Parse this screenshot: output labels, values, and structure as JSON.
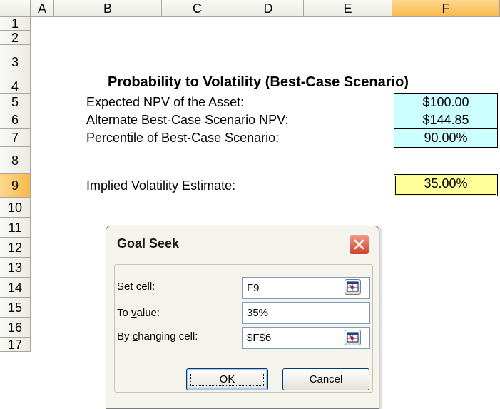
{
  "columns": [
    "A",
    "B",
    "C",
    "D",
    "E",
    "F"
  ],
  "rows": [
    "1",
    "2",
    "3",
    "4",
    "5",
    "6",
    "7",
    "8",
    "9",
    "10",
    "11",
    "12",
    "13",
    "14",
    "15",
    "16",
    "17"
  ],
  "sheet": {
    "title": "Probability to Volatility (Best-Case Scenario)",
    "expected_npv_label": "Expected NPV of the Asset:",
    "expected_npv_value": "$100.00",
    "alternate_npv_label": "Alternate Best-Case Scenario NPV:",
    "alternate_npv_value": "$144.85",
    "percentile_label": "Percentile of Best-Case Scenario:",
    "percentile_value": "90.00%",
    "implied_vol_label": "Implied Volatility Estimate:",
    "implied_vol_value": "35.00%"
  },
  "dialog": {
    "title": "Goal Seek",
    "set_cell_label_pre": "S",
    "set_cell_label_key": "e",
    "set_cell_label_post": "t cell:",
    "set_cell_value": "F9",
    "to_value_label_pre": "To ",
    "to_value_label_key": "v",
    "to_value_label_post": "alue:",
    "to_value_value": "35%",
    "changing_label_pre": "By ",
    "changing_label_key": "c",
    "changing_label_post": "hanging cell:",
    "changing_value": "$F$6",
    "ok_label": "OK",
    "cancel_label": "Cancel"
  },
  "colors": {
    "input_cell": "#ccffff",
    "output_cell": "#ffff99",
    "active_header": "#f8b94c"
  }
}
